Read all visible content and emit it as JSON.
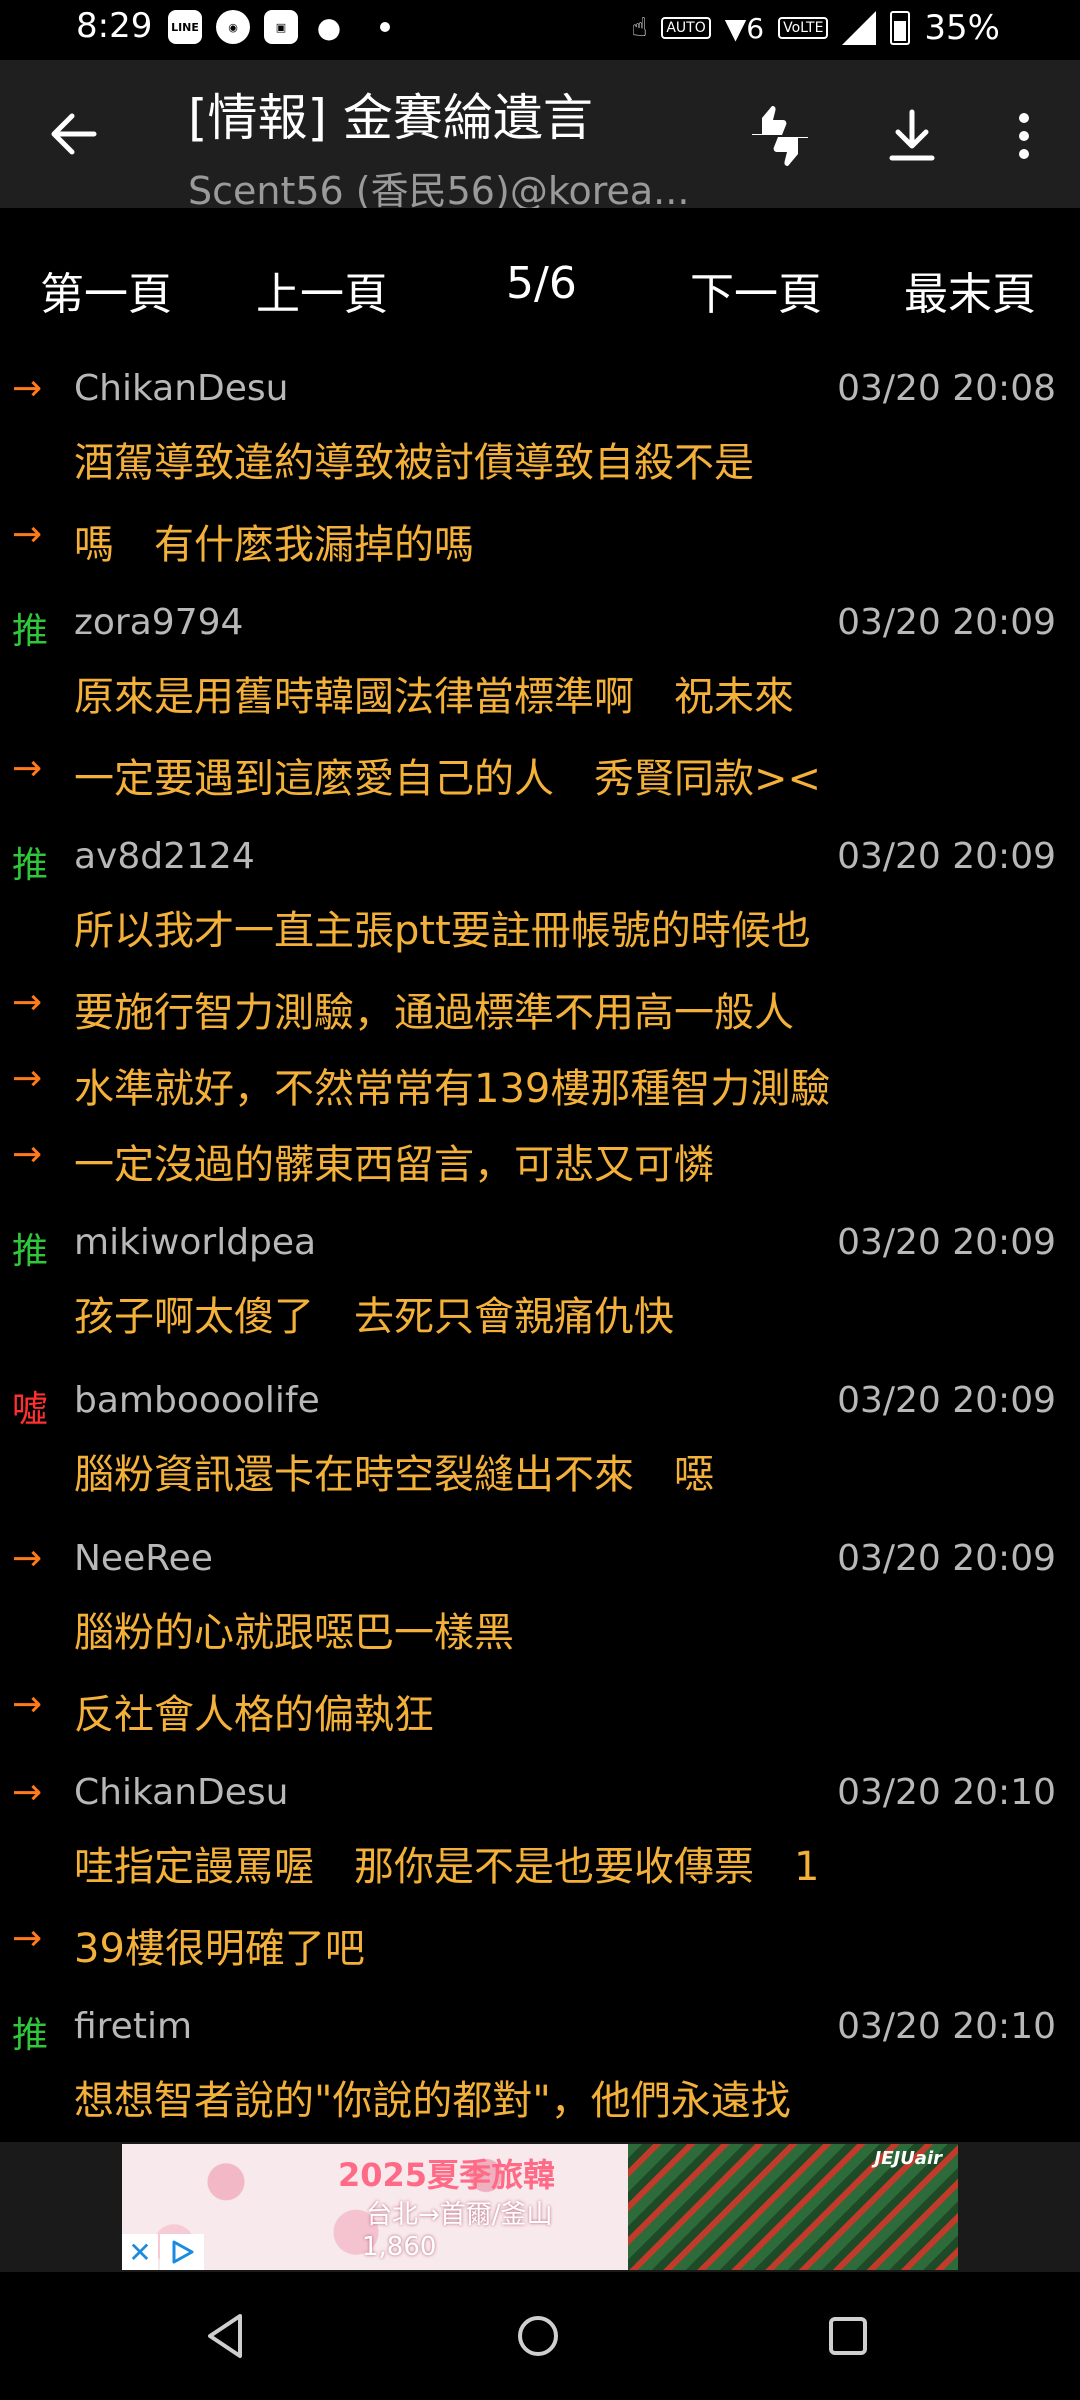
{
  "status_bar": {
    "time": "8:29",
    "battery": "35%",
    "icons": [
      "line-icon",
      "app-badge-icon",
      "app-icon",
      "reddit-icon",
      "dot-icon",
      "touch-icon",
      "auto-hz-icon",
      "wifi-6-icon",
      "volte-icon",
      "signal-icon",
      "battery-icon"
    ]
  },
  "appbar": {
    "title": "[情報] 金賽綸遺言",
    "subtitle": "Scent56 (香民56)@korea..."
  },
  "pager": {
    "first": "第一頁",
    "prev": "上一頁",
    "current": "5/6",
    "next": "下一頁",
    "last": "最末頁"
  },
  "comments": [
    {
      "tag": "→",
      "type": "arrow",
      "user": "ChikanDesu",
      "time": "03/20 20:08",
      "text": "酒駕導致違約導致被討債導致自殺不是"
    },
    {
      "tag": "→",
      "type": "arrow",
      "user": "",
      "time": "",
      "text": "嗎　有什麼我漏掉的嗎"
    },
    {
      "tag": "推",
      "type": "push",
      "user": "zora9794",
      "time": "03/20 20:09",
      "text": "原來是用舊時韓國法律當標準啊　祝未來"
    },
    {
      "tag": "→",
      "type": "arrow",
      "user": "",
      "time": "",
      "text": "一定要遇到這麼愛自己的人　秀賢同款><"
    },
    {
      "tag": "推",
      "type": "push",
      "user": "av8d2124",
      "time": "03/20 20:09",
      "text": "所以我才一直主張ptt要註冊帳號的時候也"
    },
    {
      "tag": "→",
      "type": "arrow",
      "user": "",
      "time": "",
      "text": "要施行智力測驗，通過標準不用高一般人"
    },
    {
      "tag": "→",
      "type": "arrow",
      "user": "",
      "time": "",
      "text": "水準就好，不然常常有139樓那種智力測驗"
    },
    {
      "tag": "→",
      "type": "arrow",
      "user": "",
      "time": "",
      "text": "一定沒過的髒東西留言，可悲又可憐"
    },
    {
      "tag": "推",
      "type": "push",
      "user": "mikiworldpea",
      "time": "03/20 20:09",
      "text": "孩子啊太傻了　去死只會親痛仇快"
    },
    {
      "tag": "噓",
      "type": "boo",
      "user": "bamboooolife",
      "time": "03/20 20:09",
      "text": "腦粉資訊還卡在時空裂縫出不來　噁"
    },
    {
      "tag": "→",
      "type": "arrow",
      "user": "NeeRee",
      "time": "03/20 20:09",
      "text": "腦粉的心就跟噁巴一樣黑"
    },
    {
      "tag": "→",
      "type": "arrow",
      "user": "",
      "time": "",
      "text": "反社會人格的偏執狂"
    },
    {
      "tag": "→",
      "type": "arrow",
      "user": "ChikanDesu",
      "time": "03/20 20:10",
      "text": "哇指定謾罵喔　那你是不是也要收傳票　1"
    },
    {
      "tag": "→",
      "type": "arrow",
      "user": "",
      "time": "",
      "text": "39樓很明確了吧"
    },
    {
      "tag": "推",
      "type": "push",
      "user": "firetim",
      "time": "03/20 20:10",
      "text": "想想智者說的\"你說的都對\"，他們永遠找"
    }
  ],
  "ad": {
    "title": "2025夏季旅韓",
    "route": "台北→首爾/釜山",
    "price": "1,860",
    "brand": "JEJUair"
  }
}
